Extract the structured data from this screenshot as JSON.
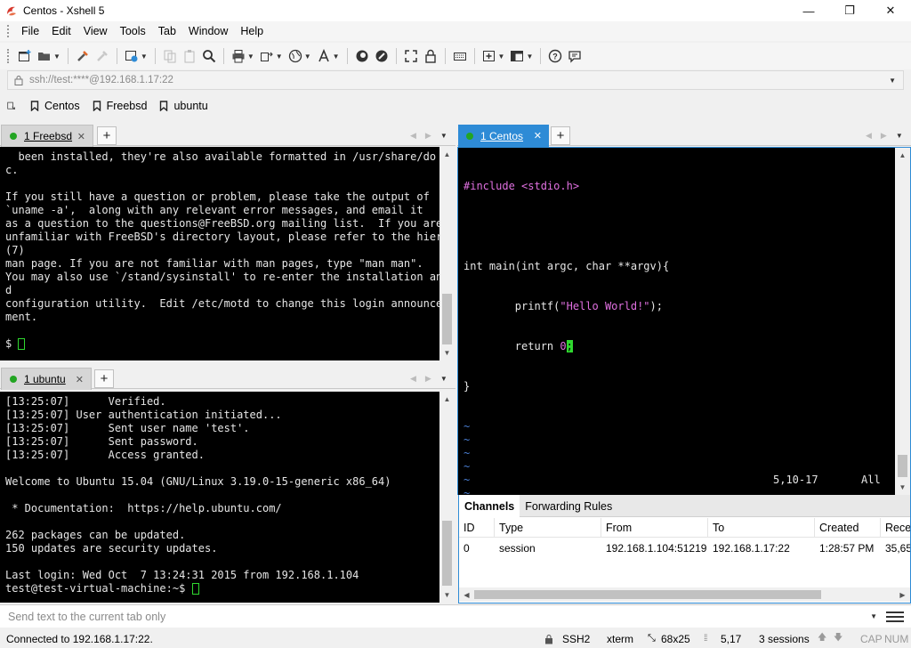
{
  "window": {
    "title": "Centos - Xshell 5",
    "minimize": "—",
    "maximize": "❐",
    "close": "✕"
  },
  "menu": [
    "File",
    "Edit",
    "View",
    "Tools",
    "Tab",
    "Window",
    "Help"
  ],
  "address": {
    "value": "ssh://test:****@192.168.1.17:22"
  },
  "links": [
    {
      "label": "Centos"
    },
    {
      "label": "Freebsd"
    },
    {
      "label": "ubuntu"
    }
  ],
  "panes": {
    "freebsd": {
      "tab_label": "1 Freebsd",
      "lines": [
        "  been installed, they're also available formatted in /usr/share/do",
        "c.",
        "",
        "If you still have a question or problem, please take the output of",
        "`uname -a',  along with any relevant error messages, and email it",
        "as a question to the questions@FreeBSD.org mailing list.  If you are",
        "unfamiliar with FreeBSD's directory layout, please refer to the hier",
        "(7)",
        "man page. If you are not familiar with man pages, type \"man man\".",
        "You may also use `/stand/sysinstall' to re-enter the installation an",
        "d",
        "configuration utility.  Edit /etc/motd to change this login announce",
        "ment.",
        ""
      ],
      "prompt": "$ "
    },
    "ubuntu": {
      "tab_label": "1 ubuntu",
      "lines": [
        "[13:25:07]      Verified.",
        "[13:25:07] User authentication initiated...",
        "[13:25:07]      Sent user name 'test'.",
        "[13:25:07]      Sent password.",
        "[13:25:07]      Access granted.",
        "",
        "Welcome to Ubuntu 15.04 (GNU/Linux 3.19.0-15-generic x86_64)",
        "",
        " * Documentation:  https://help.ubuntu.com/",
        "",
        "262 packages can be updated.",
        "150 updates are security updates.",
        "",
        "Last login: Wed Oct  7 13:24:31 2015 from 192.168.1.104"
      ],
      "prompt": "test@test-virtual-machine:~$ "
    },
    "centos": {
      "tab_label": "1 Centos",
      "code": {
        "include_kw": "#include ",
        "include_file": "<stdio.h>",
        "main_sig": "int main(int argc, char **argv){",
        "printf_pre": "        printf(",
        "printf_str": "\"Hello World!\"",
        "printf_post": ");",
        "return_pre": "        return ",
        "return_cursor": "0",
        "return_post": ";",
        "close_brace": "}"
      },
      "tilde": "~",
      "ruler_pos": "5,10-17",
      "ruler_all": "All"
    }
  },
  "channels": {
    "tabs": [
      "Channels",
      "Forwarding Rules"
    ],
    "columns": [
      "ID",
      "Type",
      "From",
      "To",
      "Created",
      "Recei"
    ],
    "rows": [
      {
        "id": "0",
        "type": "session",
        "from": "192.168.1.104:51219",
        "to": "192.168.1.17:22",
        "created": "1:28:57 PM",
        "received": "35,65"
      }
    ]
  },
  "send_bar": {
    "placeholder": "Send text to the current tab only"
  },
  "status": {
    "connection": "Connected to 192.168.1.17:22.",
    "protocol": "SSH2",
    "terminal": "xterm",
    "size": "68x25",
    "cursor": "5,17",
    "sessions": "3 sessions",
    "caps": "CAP",
    "num": "NUM"
  },
  "colors": {
    "active_tab": "#2e8bd6",
    "connected_dot": "#23a523",
    "cursor": "#2fd82f",
    "vim_string": "#e070e0",
    "vim_tilde": "#4a7fd4"
  },
  "icons": [
    "app-logo-icon",
    "new-session-icon",
    "open-folder-icon",
    "reconnect-icon",
    "disconnect-icon",
    "properties-icon",
    "copy-icon",
    "paste-icon",
    "find-icon",
    "print-icon",
    "transfer-icon",
    "globe-icon",
    "font-icon",
    "xftp-icon",
    "xmanager-icon",
    "fullscreen-icon",
    "lock-icon",
    "keyboard-icon",
    "compose-icon",
    "layout-icon",
    "help-icon",
    "chat-icon",
    "bookmark-icon"
  ]
}
